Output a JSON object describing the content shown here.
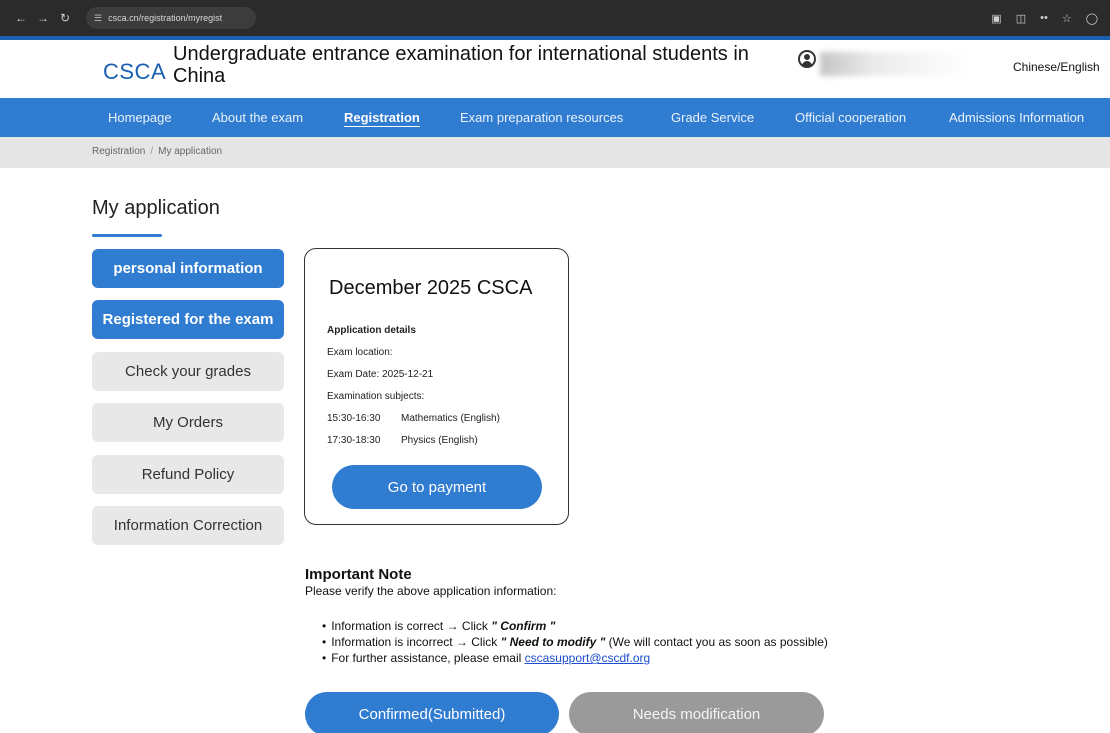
{
  "browser": {
    "url": "csca.cn/registration/myregist"
  },
  "header": {
    "logo": "CSCA",
    "title": "Undergraduate entrance examination for international students in China",
    "language_toggle": "Chinese/English"
  },
  "nav": {
    "items": [
      {
        "label": "Homepage",
        "active": false
      },
      {
        "label": "About the exam",
        "active": false
      },
      {
        "label": "Registration",
        "active": true
      },
      {
        "label": "Exam preparation resources",
        "active": false
      },
      {
        "label": "Grade Service",
        "active": false
      },
      {
        "label": "Official cooperation",
        "active": false
      },
      {
        "label": "Admissions Information",
        "active": false
      }
    ]
  },
  "breadcrumb": {
    "parent": "Registration",
    "current": "My application"
  },
  "page_title": "My application",
  "side_menu": {
    "items": [
      {
        "label": "personal information",
        "style": "primary"
      },
      {
        "label": "Registered for the exam",
        "style": "primary"
      },
      {
        "label": "Check your grades",
        "style": "secondary"
      },
      {
        "label": "My Orders",
        "style": "secondary"
      },
      {
        "label": "Refund Policy",
        "style": "secondary"
      },
      {
        "label": "Information Correction",
        "style": "secondary"
      }
    ]
  },
  "application_card": {
    "title": "December 2025 CSCA",
    "details_header": "Application details",
    "exam_location": "Exam location:",
    "exam_date": "Exam Date: 2025-12-21",
    "subjects_header": "Examination subjects:",
    "subjects": [
      {
        "time": "15:30-16:30",
        "name": "Mathematics (English)"
      },
      {
        "time": "17:30-18:30",
        "name": "Physics (English)"
      }
    ],
    "pay_button": "Go to payment"
  },
  "note": {
    "title": "Important Note",
    "subtitle": "Please verify the above application information:",
    "bullet1_prefix": "Information is correct → Click ",
    "bullet1_action": "\" Confirm \"",
    "bullet2_prefix": "Information is incorrect → Click ",
    "bullet2_action": "\" Need to modify \"",
    "bullet2_suffix": " (We will contact you as soon as possible)",
    "bullet3_prefix": "For further assistance, please email ",
    "email": "cscasupport@cscdf.org"
  },
  "actions": {
    "confirm": "Confirmed(Submitted)",
    "modify": "Needs modification"
  },
  "colors": {
    "nav_blue": "#2f7cd1",
    "secondary_gray": "#e8e8e8",
    "disabled_gray": "#9a9a9a"
  }
}
